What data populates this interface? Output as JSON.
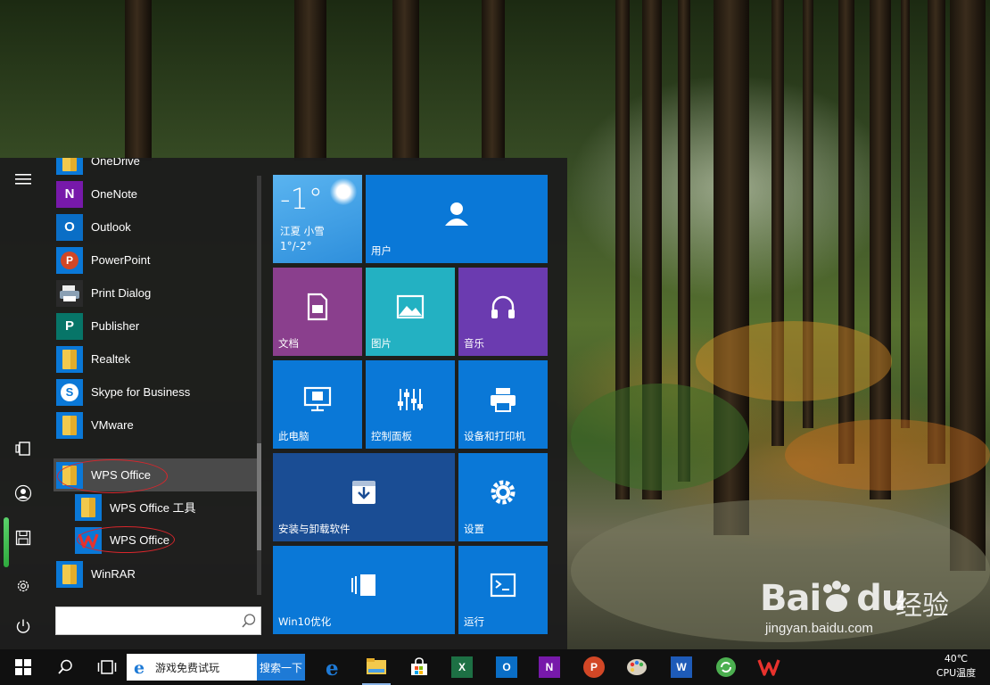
{
  "start_menu": {
    "apps": [
      {
        "label": "OneDrive",
        "icon": "folder-icon"
      },
      {
        "label": "OneNote",
        "icon": "onenote-icon"
      },
      {
        "label": "Outlook",
        "icon": "outlook-icon"
      },
      {
        "label": "PowerPoint",
        "icon": "powerpoint-icon"
      },
      {
        "label": "Print Dialog",
        "icon": "print-dialog-icon"
      },
      {
        "label": "Publisher",
        "icon": "publisher-icon"
      },
      {
        "label": "Realtek",
        "icon": "folder-icon"
      },
      {
        "label": "Skype for Business",
        "icon": "skype-icon"
      },
      {
        "label": "VMware",
        "icon": "folder-icon"
      },
      {
        "label": "WPS Office",
        "icon": "folder-icon"
      },
      {
        "label": "WPS Office 工具",
        "icon": "folder-icon"
      },
      {
        "label": "WPS Office",
        "icon": "wps-icon"
      },
      {
        "label": "WinRAR",
        "icon": "folder-icon"
      }
    ],
    "search_placeholder": ""
  },
  "tiles": {
    "weather": {
      "temp": "-1°",
      "city": "江夏 小雪",
      "range": "1°/-2°"
    },
    "user": "用户",
    "documents": "文档",
    "pictures": "图片",
    "music": "音乐",
    "this_pc": "此电脑",
    "control_panel": "控制面板",
    "devices_printers": "设备和打印机",
    "install_uninstall": "安装与卸载软件",
    "settings": "设置",
    "win10_optimize": "Win10优化",
    "run": "运行"
  },
  "taskbar": {
    "ie_text": "游戏免费试玩",
    "search_button": "搜索一下",
    "cpu_temp": "40℃",
    "cpu_label": "CPU温度"
  },
  "watermark": {
    "logo": "Bai",
    "logo_end": "du",
    "cn": "经验",
    "url": "jingyan.baidu.com"
  },
  "colors": {
    "tile_blue": "#0a78d7",
    "tile_purple": "#8a3f8d",
    "tile_teal": "#23b1c2",
    "tile_violet": "#6b3bb0",
    "tile_navy": "#1a4d94",
    "annotation_red": "#d9262c"
  }
}
